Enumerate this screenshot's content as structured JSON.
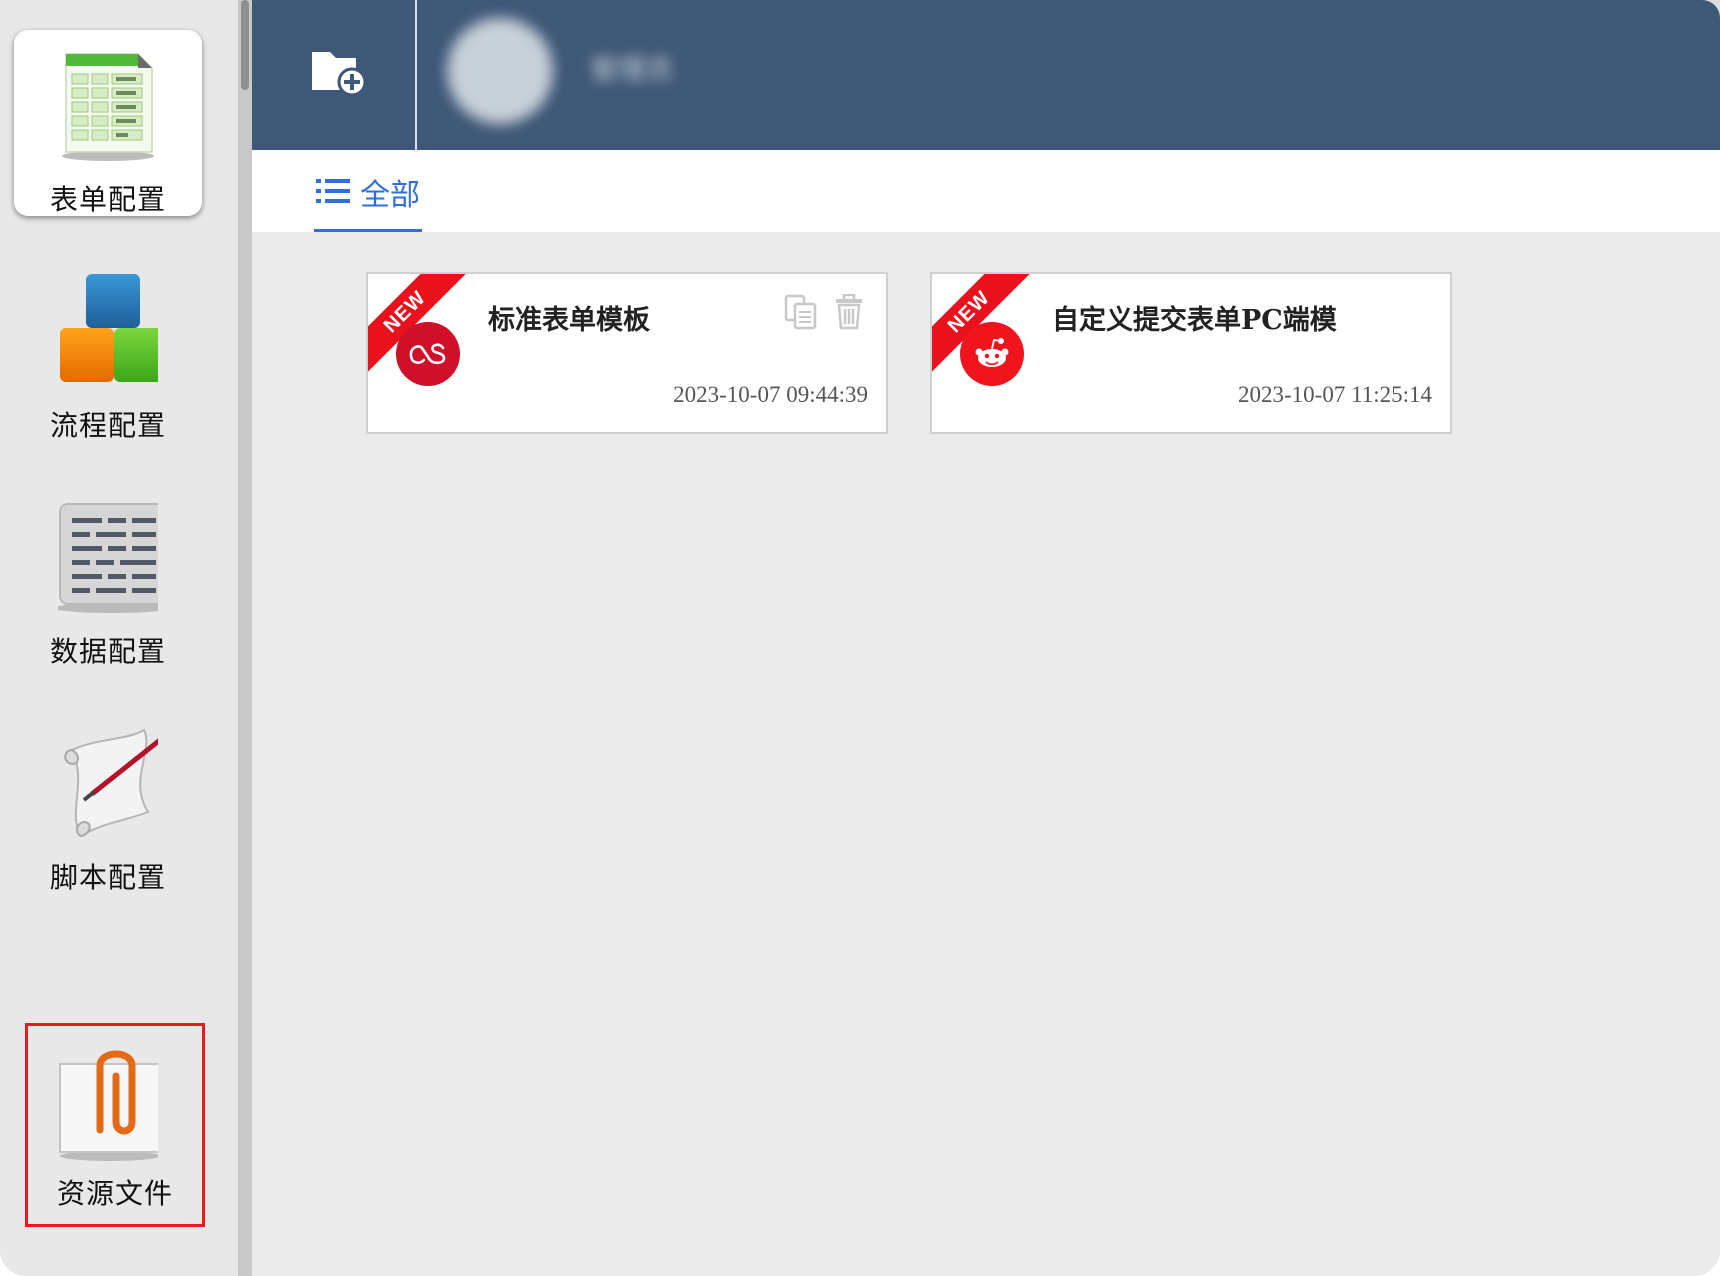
{
  "sidebar": {
    "items": [
      {
        "label": "表单配置",
        "icon": "form-sheet-icon",
        "active": true
      },
      {
        "label": "流程配置",
        "icon": "process-blocks-icon"
      },
      {
        "label": "数据配置",
        "icon": "data-grid-icon"
      },
      {
        "label": "脚本配置",
        "icon": "script-scroll-icon"
      },
      {
        "label": "资源文件",
        "icon": "paperclip-file-icon",
        "highlighted": true
      }
    ]
  },
  "header": {
    "new_folder_icon": "new-folder-icon",
    "user_name": "管理员"
  },
  "tabs": [
    {
      "label": "全部",
      "icon": "list-icon",
      "active": true
    }
  ],
  "cards": [
    {
      "badge": "NEW",
      "title": "标准表单模板",
      "time": "2023-10-07 09:44:39",
      "logo": "lastfm-logo",
      "logo_color": "#d0102a"
    },
    {
      "badge": "NEW",
      "title": "自定义提交表单PC端模",
      "time": "2023-10-07 11:25:14",
      "logo": "reddit-logo",
      "logo_color": "#f0141c"
    }
  ],
  "colors": {
    "header_bg": "#3e5877",
    "accent_blue": "#2f6fd6",
    "ribbon_red": "#e8111c",
    "highlight_red": "#e8191f"
  }
}
